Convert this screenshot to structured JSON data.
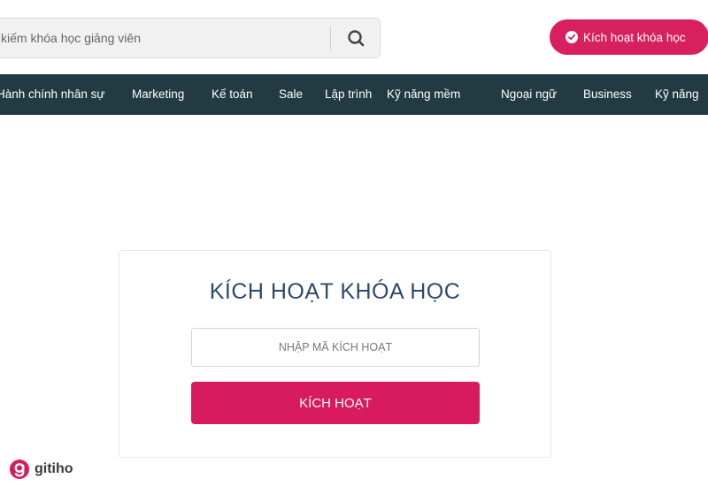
{
  "search": {
    "placeholder": "kiếm khóa học giảng viên",
    "icon": "search-icon"
  },
  "header": {
    "activate_label": "Kích hoạt khóa học",
    "accent_color": "#d9205e"
  },
  "nav": {
    "background": "#223b42",
    "items": [
      "Hành chính nhân sự",
      "Marketing",
      "Kế toán",
      "Sale",
      "Lập trình",
      "Kỹ năng mềm",
      "Ngoại ngữ",
      "Business",
      "Kỹ năng"
    ]
  },
  "activation": {
    "title": "KÍCH HOẠT KHÓA HỌC",
    "code_placeholder": "NHẬP MÃ KÍCH HOẠT",
    "submit_label": "KÍCH HOẠT"
  },
  "brand": {
    "name": "gitiho"
  }
}
